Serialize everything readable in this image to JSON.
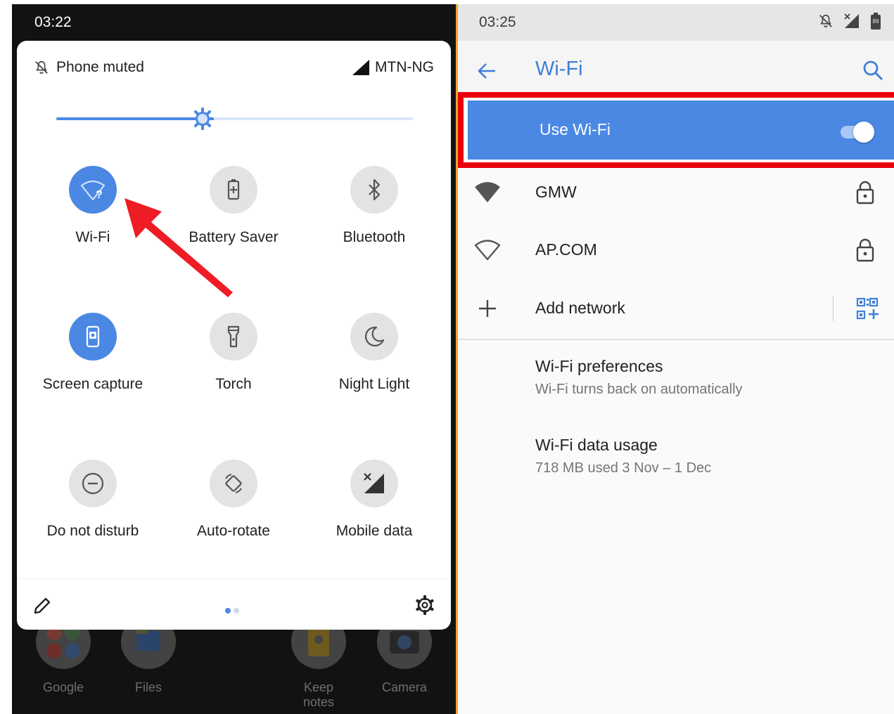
{
  "left_phone": {
    "status_time": "03:22",
    "home_apps": [
      {
        "label": "Google",
        "icon": "google-folder-icon"
      },
      {
        "label": "Files",
        "icon": "files-icon"
      },
      {
        "label": "Keep notes",
        "icon": "keep-notes-icon"
      },
      {
        "label": "Camera",
        "icon": "camera-icon"
      }
    ],
    "shade": {
      "header_left_label": "Phone muted",
      "header_right_label": "MTN-NG",
      "brightness": 0.41,
      "tiles": [
        {
          "label": "Wi-Fi",
          "icon": "wifi-question-icon",
          "active": true
        },
        {
          "label": "Battery Saver",
          "icon": "battery-saver-icon",
          "active": false
        },
        {
          "label": "Bluetooth",
          "icon": "bluetooth-icon",
          "active": false
        },
        {
          "label": "Screen capture",
          "icon": "screen-capture-icon",
          "active": true
        },
        {
          "label": "Torch",
          "icon": "torch-icon",
          "active": false
        },
        {
          "label": "Night Light",
          "icon": "night-light-icon",
          "active": false
        },
        {
          "label": "Do not disturb",
          "icon": "do-not-disturb-icon",
          "active": false
        },
        {
          "label": "Auto-rotate",
          "icon": "auto-rotate-icon",
          "active": false
        },
        {
          "label": "Mobile data",
          "icon": "mobile-data-off-icon",
          "active": false
        }
      ]
    }
  },
  "right_phone": {
    "status_time": "03:25",
    "battery_level": "89",
    "title": "Wi-Fi",
    "use_wifi_label": "Use Wi-Fi",
    "use_wifi_on": true,
    "networks": [
      {
        "name": "GMW",
        "secured": true,
        "signal": "full"
      },
      {
        "name": "AP.COM",
        "secured": true,
        "signal": "weak"
      }
    ],
    "add_network_label": "Add network",
    "preferences": [
      {
        "title": "Wi-Fi preferences",
        "subtitle": "Wi-Fi turns back on automatically"
      },
      {
        "title": "Wi-Fi data usage",
        "subtitle": "718 MB used 3 Nov – 1 Dec"
      }
    ]
  },
  "colors": {
    "accent_blue": "#4a88e4",
    "title_blue": "#3f7fd9",
    "highlight_red": "#e8000d",
    "divider_orange": "#f2a32a"
  }
}
